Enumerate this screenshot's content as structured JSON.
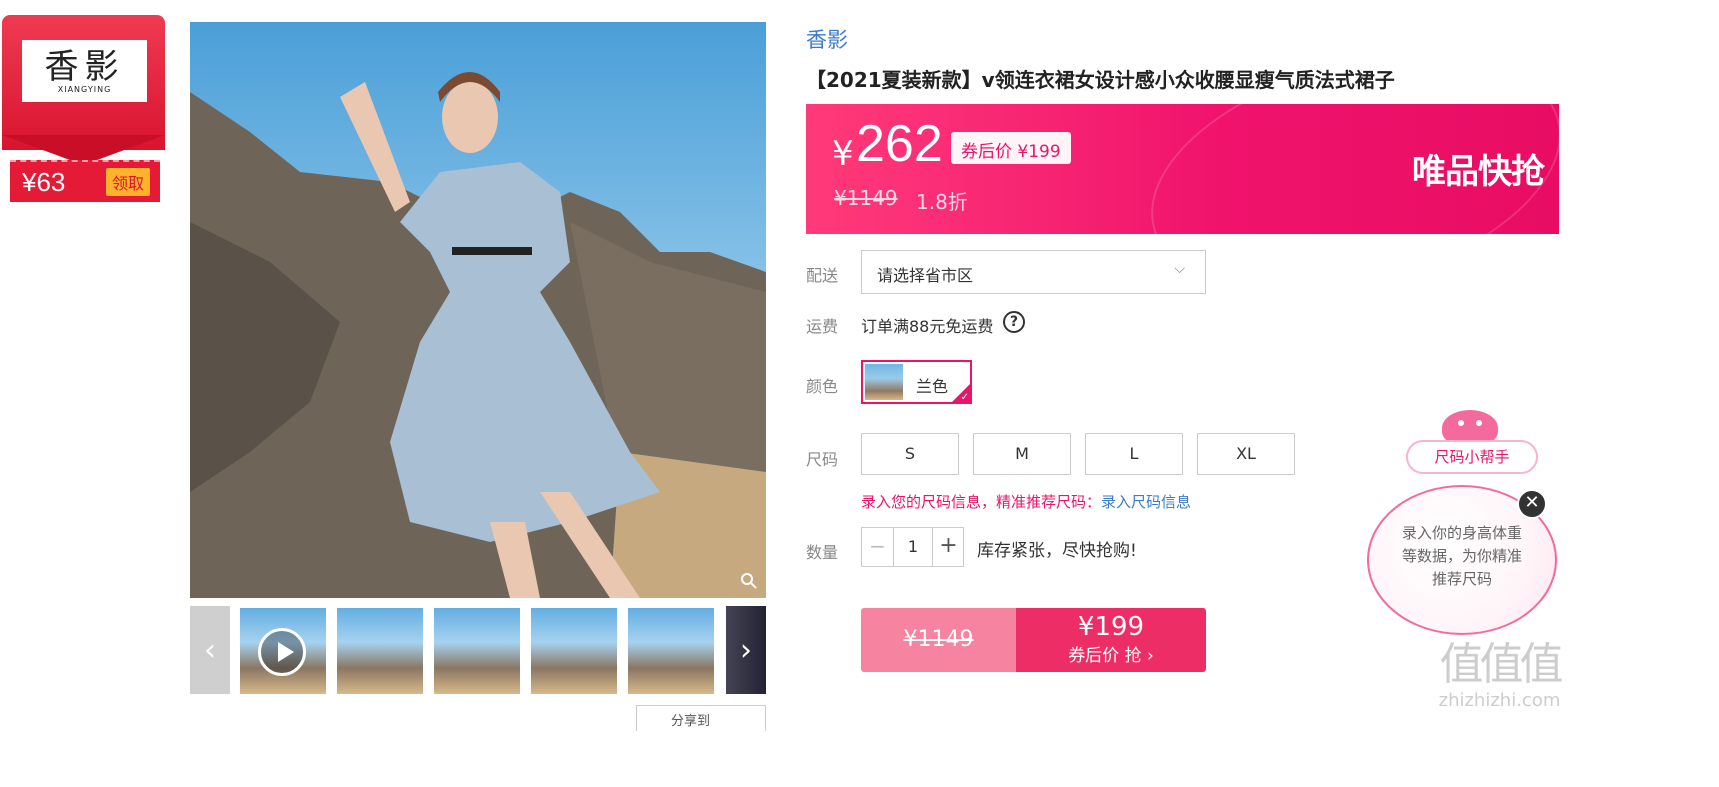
{
  "coupon": {
    "logo_main": "香影",
    "logo_sub": "XIANGYING",
    "amount": "¥63",
    "get_label": "领取"
  },
  "gallery": {
    "thumb_prev": "‹",
    "thumb_next": "›",
    "share_label": "分享到"
  },
  "product": {
    "brand": "香影",
    "title": "【2021夏装新款】v领连衣裙女设计感小众收腰显瘦气质法式裙子"
  },
  "price_banner": {
    "currency": "¥",
    "price": "262",
    "after_coupon": "券后价 ¥199",
    "original": "¥1149",
    "discount": "1.8折",
    "flash_label": "唯品快抢"
  },
  "delivery": {
    "label": "配送",
    "placeholder": "请选择省市区"
  },
  "freight": {
    "label": "运费",
    "text": "订单满88元免运费"
  },
  "color": {
    "label": "颜色",
    "selected": "兰色"
  },
  "size": {
    "label": "尺码",
    "options": [
      "S",
      "M",
      "L",
      "XL"
    ],
    "tip_prefix": "录入您的尺码信息，精准推荐尺码：",
    "tip_link": "录入尺码信息"
  },
  "quantity": {
    "label": "数量",
    "minus": "−",
    "value": "1",
    "plus": "+",
    "stock_tip": "库存紧张，尽快抢购!"
  },
  "buy": {
    "original": "¥1149",
    "price": "¥199",
    "label": "券后价 抢 ›"
  },
  "size_helper": {
    "pill": "尺码小帮手",
    "text": "录入你的身高体重等数据，为你精准推荐尺码",
    "close": "✕"
  },
  "watermark": {
    "big": "值值值",
    "small": "zhizhizhi.com"
  },
  "colors": {
    "accent": "#e8156a",
    "brand_blue": "#3b7bcb",
    "coupon_red": "#d9142f"
  }
}
